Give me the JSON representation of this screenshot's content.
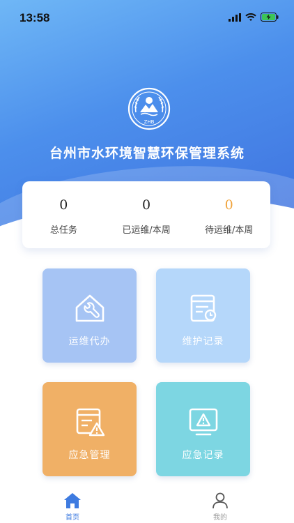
{
  "status_bar": {
    "time": "13:58"
  },
  "header": {
    "logo_text": "ZHB",
    "title": "台州市水环境智慧环保管理系统"
  },
  "stats": [
    {
      "value": "0",
      "label": "总任务"
    },
    {
      "value": "0",
      "label": "已运维/本周"
    },
    {
      "value": "0",
      "label": "待运维/本周"
    }
  ],
  "tiles": [
    {
      "label": "运维代办",
      "icon": "wrench-house-icon"
    },
    {
      "label": "维护记录",
      "icon": "record-list-icon"
    },
    {
      "label": "应急管理",
      "icon": "warning-document-icon"
    },
    {
      "label": "应急记录",
      "icon": "warning-monitor-icon"
    }
  ],
  "tabbar": {
    "home_label": "首页",
    "mine_label": "我的",
    "active_color": "#3e7be0"
  },
  "colors": {
    "hero_top": "#6fb7f6",
    "hero_bottom": "#3f72df",
    "pending_accent": "#f0a33b",
    "tile_1": "#a6c4f4",
    "tile_2": "#b5d7fa",
    "tile_3": "#f0b066",
    "tile_4": "#7dd6e2"
  }
}
